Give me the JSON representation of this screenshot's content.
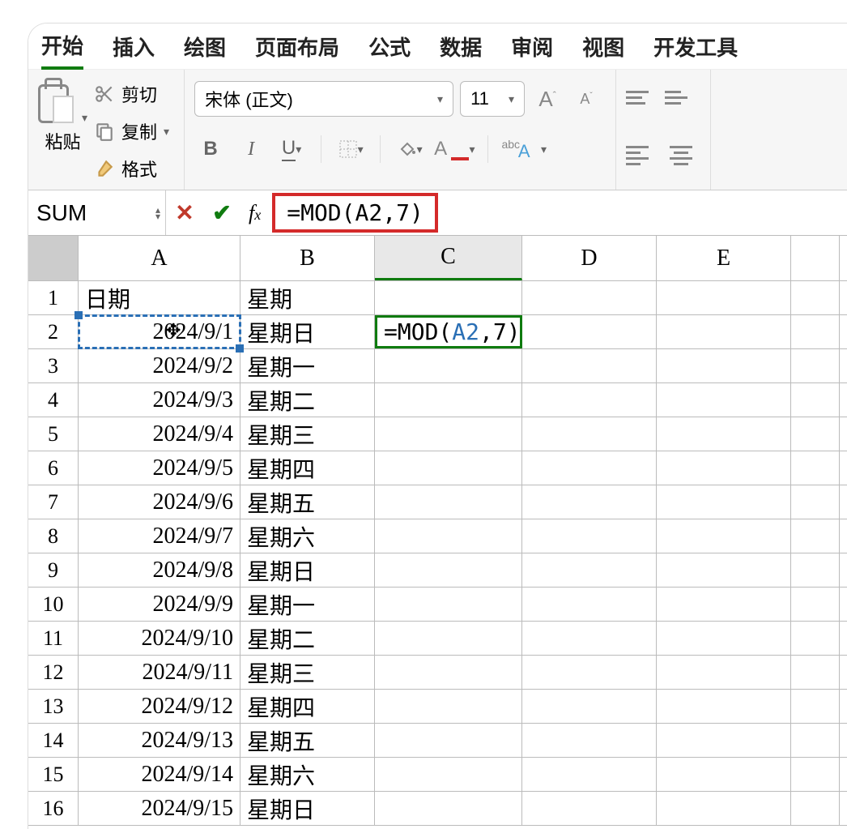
{
  "tabs": [
    "开始",
    "插入",
    "绘图",
    "页面布局",
    "公式",
    "数据",
    "审阅",
    "视图",
    "开发工具"
  ],
  "active_tab": 0,
  "clipboard": {
    "paste": "粘贴",
    "cut": "剪切",
    "copy": "复制",
    "format": "格式"
  },
  "font": {
    "name": "宋体 (正文)",
    "size": "11"
  },
  "name_box": "SUM",
  "formula_bar": "=MOD(A2,7)",
  "columns": [
    "A",
    "B",
    "C",
    "D",
    "E"
  ],
  "headers": {
    "A": "日期",
    "B": "星期"
  },
  "edit_cell": {
    "row": 2,
    "col": "C",
    "prefix": "=MOD(",
    "ref": "A2",
    "suffix": ",7)"
  },
  "referenced_cell": {
    "row": 2,
    "col": "A"
  },
  "rows": [
    {
      "n": 1,
      "A": "日期",
      "B": "星期"
    },
    {
      "n": 2,
      "A": "2024/9/1",
      "B": "星期日"
    },
    {
      "n": 3,
      "A": "2024/9/2",
      "B": "星期一"
    },
    {
      "n": 4,
      "A": "2024/9/3",
      "B": "星期二"
    },
    {
      "n": 5,
      "A": "2024/9/4",
      "B": "星期三"
    },
    {
      "n": 6,
      "A": "2024/9/5",
      "B": "星期四"
    },
    {
      "n": 7,
      "A": "2024/9/6",
      "B": "星期五"
    },
    {
      "n": 8,
      "A": "2024/9/7",
      "B": "星期六"
    },
    {
      "n": 9,
      "A": "2024/9/8",
      "B": "星期日"
    },
    {
      "n": 10,
      "A": "2024/9/9",
      "B": "星期一"
    },
    {
      "n": 11,
      "A": "2024/9/10",
      "B": "星期二"
    },
    {
      "n": 12,
      "A": "2024/9/11",
      "B": "星期三"
    },
    {
      "n": 13,
      "A": "2024/9/12",
      "B": "星期四"
    },
    {
      "n": 14,
      "A": "2024/9/13",
      "B": "星期五"
    },
    {
      "n": 15,
      "A": "2024/9/14",
      "B": "星期六"
    },
    {
      "n": 16,
      "A": "2024/9/15",
      "B": "星期日"
    }
  ]
}
